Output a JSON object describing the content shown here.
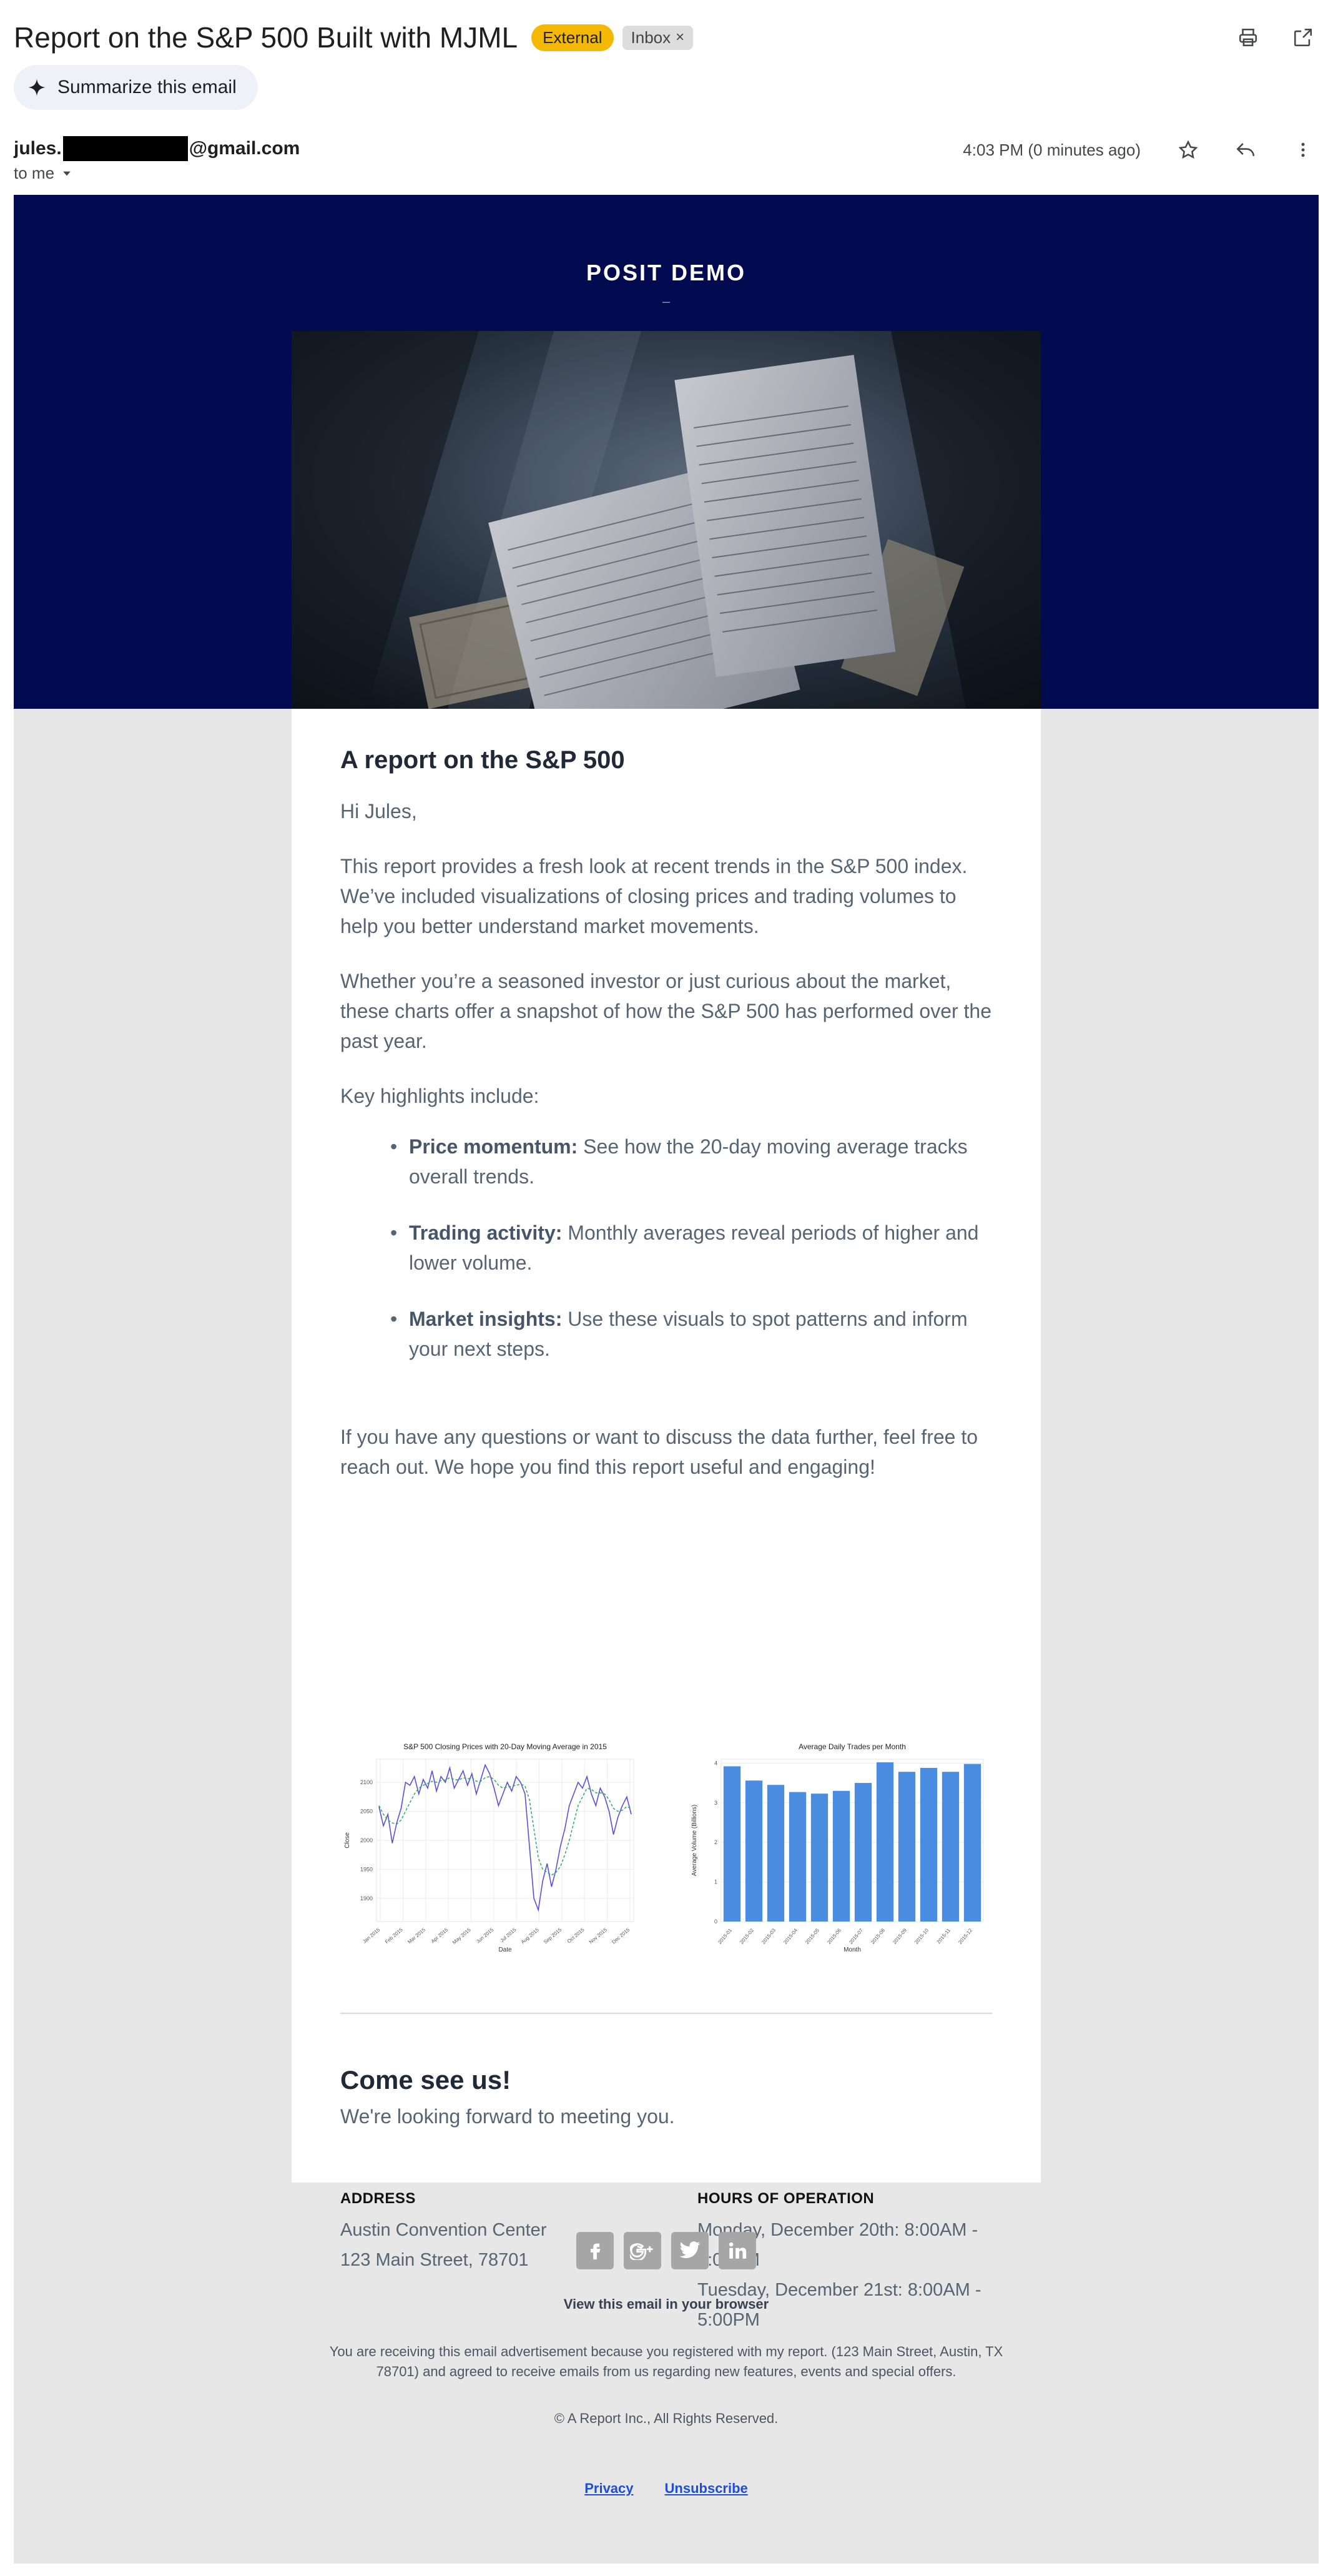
{
  "header": {
    "subject": "Report on the S&P 500 Built with MJML",
    "labels": {
      "external": "External",
      "inbox": "Inbox",
      "inbox_remove": "×"
    },
    "summarize_label": "Summarize this email"
  },
  "sender": {
    "prefix": "jules.",
    "suffix": "@gmail.com",
    "to_label": "to me",
    "time": "4:03 PM (0 minutes ago)"
  },
  "email": {
    "brand": "POSIT DEMO",
    "brand_dash": "–",
    "title": "A report on the S&P 500",
    "greeting": "Hi Jules,",
    "para1": "This report provides a fresh look at recent trends in the S&P 500 index. We’ve included visualizations of closing prices and trading volumes to help you better understand market movements.",
    "para2": "Whether you’re a seasoned investor or just curious about the market, these charts offer a snapshot of how the S&P 500 has performed over the past year.",
    "highlights_intro": "Key highlights include:",
    "bullets": [
      {
        "bold": "Price momentum:",
        "text": " See how the 20-day moving average tracks overall trends."
      },
      {
        "bold": "Trading activity:",
        "text": " Monthly averages reveal periods of higher and lower volume."
      },
      {
        "bold": "Market insights:",
        "text": " Use these visuals to spot patterns and inform your next steps."
      }
    ],
    "closing": "If you have any questions or want to discuss the data further, feel free to reach out. We hope you find this report useful and engaging!",
    "come_title": "Come see us!",
    "come_sub": "We're looking forward to meeting you.",
    "address_heading": "ADDRESS",
    "address_line1": "Austin Convention Center",
    "address_line2": "123 Main Street, 78701",
    "hours_heading": "HOURS OF OPERATION",
    "hours_line1": "Monday, December 20th: 8:00AM -",
    "hours_line1b": "5:00PM",
    "hours_line2": "Tuesday, December 21st: 8:00AM -",
    "hours_line2b": "5:00PM"
  },
  "footer": {
    "view_browser": "View this email in your browser",
    "notice": "You are receiving this email advertisement because you registered with my report. (123 Main Street, Austin, TX 78701) and agreed to receive emails from us regarding new features, events and special offers.",
    "copyright": "© A Report Inc., All Rights Reserved.",
    "privacy": "Privacy",
    "unsubscribe": "Unsubscribe",
    "social": [
      "facebook-icon",
      "google-plus-icon",
      "twitter-icon",
      "linkedin-icon"
    ]
  },
  "chart_data": [
    {
      "type": "line",
      "title": "S&P 500 Closing Prices with 20-Day Moving Average in 2015",
      "xlabel": "Date",
      "ylabel": "Close",
      "x_ticks": [
        "Jan 2015",
        "Feb 2015",
        "Mar 2015",
        "Apr 2015",
        "May 2015",
        "Jun 2015",
        "Jul 2015",
        "Aug 2015",
        "Sep 2015",
        "Oct 2015",
        "Nov 2015",
        "Dec 2015"
      ],
      "y_ticks": [
        1900,
        1950,
        2000,
        2050,
        2100
      ],
      "ylim": [
        1860,
        2140
      ],
      "series": [
        {
          "values": [
            2058,
            2025,
            2045,
            1995,
            2030,
            2055,
            2100,
            2095,
            2110,
            2080,
            2105,
            2090,
            2120,
            2085,
            2110,
            2100,
            2125,
            2090,
            2105,
            2120,
            2095,
            2115,
            2080,
            2105,
            2130,
            2115,
            2090,
            2060,
            2080,
            2100,
            2085,
            2110,
            2100,
            2080,
            1990,
            1900,
            1880,
            1930,
            1960,
            1920,
            1950,
            1990,
            2020,
            2060,
            2080,
            2100,
            2090,
            2110,
            2080,
            2060,
            2090,
            2075,
            2050,
            2010,
            2040,
            2060,
            2075,
            2045
          ]
        },
        {
          "values": [
            2060,
            2045,
            2035,
            2030,
            2028,
            2035,
            2050,
            2065,
            2080,
            2090,
            2095,
            2098,
            2102,
            2100,
            2103,
            2104,
            2108,
            2105,
            2104,
            2108,
            2106,
            2108,
            2102,
            2102,
            2108,
            2110,
            2105,
            2095,
            2090,
            2092,
            2093,
            2095,
            2097,
            2094,
            2070,
            2020,
            1970,
            1950,
            1945,
            1940,
            1945,
            1955,
            1975,
            2000,
            2030,
            2060,
            2075,
            2090,
            2088,
            2082,
            2082,
            2080,
            2070,
            2055,
            2050,
            2052,
            2058,
            2055
          ]
        }
      ],
      "colors": [
        "#5a4fd8",
        "#29a86a"
      ]
    },
    {
      "type": "bar",
      "title": "Average Daily Trades per Month",
      "xlabel": "Month",
      "ylabel": "Average Volume (Billions)",
      "categories": [
        "2015-01",
        "2015-02",
        "2015-03",
        "2015-04",
        "2015-05",
        "2015-06",
        "2015-07",
        "2015-08",
        "2015-09",
        "2015-10",
        "2015-11",
        "2015-12"
      ],
      "values": [
        3.92,
        3.56,
        3.45,
        3.27,
        3.23,
        3.3,
        3.5,
        4.02,
        3.78,
        3.88,
        3.78,
        3.98
      ],
      "y_ticks": [
        0,
        1,
        2,
        3,
        4
      ],
      "ylim": [
        0,
        4.1
      ],
      "color": "#4a8de0"
    }
  ]
}
